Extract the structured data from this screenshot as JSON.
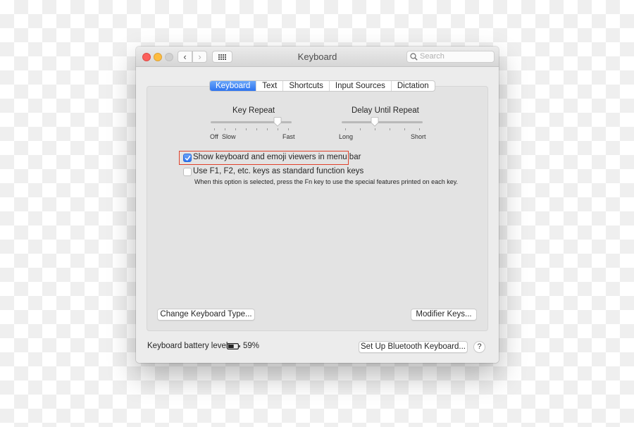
{
  "window": {
    "title": "Keyboard",
    "search_placeholder": "Search"
  },
  "tabs": [
    {
      "label": "Keyboard",
      "active": true
    },
    {
      "label": "Text",
      "active": false
    },
    {
      "label": "Shortcuts",
      "active": false
    },
    {
      "label": "Input Sources",
      "active": false
    },
    {
      "label": "Dictation",
      "active": false
    }
  ],
  "key_repeat": {
    "title": "Key Repeat",
    "labels": {
      "off": "Off",
      "slow": "Slow",
      "fast": "Fast"
    },
    "tick_count": 8,
    "value_index": 6
  },
  "delay_until_repeat": {
    "title": "Delay Until Repeat",
    "labels": {
      "long": "Long",
      "short": "Short"
    },
    "tick_count": 6,
    "value_index": 2
  },
  "options": {
    "show_viewers": {
      "label": "Show keyboard and emoji viewers in menu bar",
      "checked": true
    },
    "use_fn_keys": {
      "label": "Use F1, F2, etc. keys as standard function keys",
      "checked": false
    },
    "fn_note": "When this option is selected, press the Fn key to use the special features printed on each key."
  },
  "buttons": {
    "change_type": "Change Keyboard Type...",
    "modifier_keys": "Modifier Keys...",
    "bluetooth": "Set Up Bluetooth Keyboard...",
    "help": "?"
  },
  "battery": {
    "label": "Keyboard battery level:",
    "percent_text": "59%",
    "level": 0.59
  },
  "colors": {
    "accent": "#2d73ef",
    "highlight_border": "#e0412b"
  }
}
